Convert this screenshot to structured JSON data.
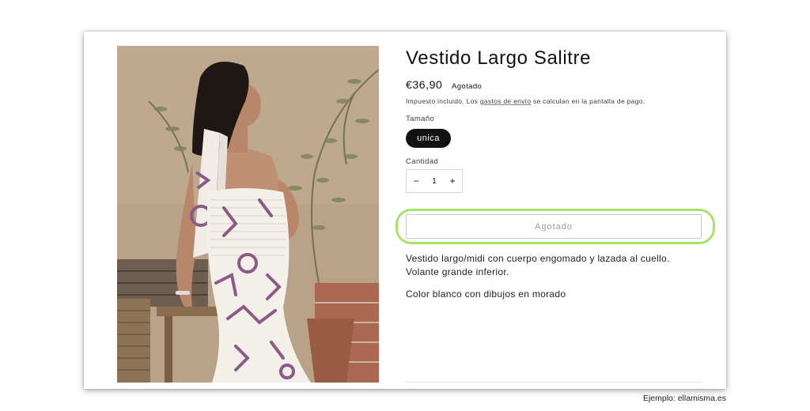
{
  "product": {
    "title": "Vestido Largo Salitre",
    "price": "€36,90",
    "status_badge": "Agotado",
    "tax_note_prefix": "Impuesto incluido. Los ",
    "tax_note_link": "gastos de envío",
    "tax_note_suffix": " se calculan en la pantalla de pago.",
    "size_label": "Tamaño",
    "size_selected": "unica",
    "quantity_label": "Cantidad",
    "quantity_value": "1",
    "decrement_symbol": "−",
    "increment_symbol": "+",
    "add_button_label": "Agotado",
    "description_line1": "Vestido largo/midi con cuerpo engomado y lazada al cuello.",
    "description_line2": "Volante grande inferior.",
    "description_color": "Color blanco con dibujos en morado"
  },
  "caption": "Ejemplo: ellamisma.es",
  "colors": {
    "highlight": "#a7e26a",
    "pill_bg": "#121212",
    "dress_pattern": "#8c5a87"
  }
}
